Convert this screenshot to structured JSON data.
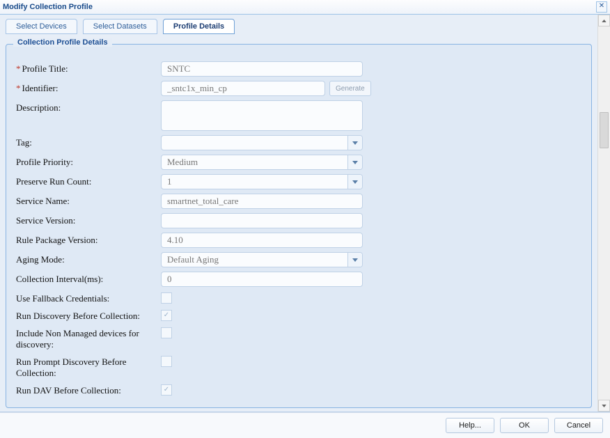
{
  "window": {
    "title": "Modify Collection Profile"
  },
  "tabs": [
    {
      "label": "Select Devices",
      "active": false
    },
    {
      "label": "Select Datasets",
      "active": false
    },
    {
      "label": "Profile Details",
      "active": true
    }
  ],
  "fieldset_title": "Collection Profile Details",
  "form": {
    "profile_title": {
      "label": "Profile Title:",
      "value": "SNTC",
      "required": true
    },
    "identifier": {
      "label": "Identifier:",
      "value": "_sntc1x_min_cp",
      "required": true,
      "generate_label": "Generate"
    },
    "description": {
      "label": "Description:",
      "value": ""
    },
    "tag": {
      "label": "Tag:",
      "value": ""
    },
    "profile_priority": {
      "label": "Profile Priority:",
      "value": "Medium"
    },
    "preserve_run_count": {
      "label": "Preserve Run Count:",
      "value": "1"
    },
    "service_name": {
      "label": "Service Name:",
      "value": "smartnet_total_care"
    },
    "service_version": {
      "label": "Service Version:",
      "value": ""
    },
    "rule_package_version": {
      "label": "Rule Package Version:",
      "value": "4.10"
    },
    "aging_mode": {
      "label": "Aging Mode:",
      "value": "Default Aging"
    },
    "collection_interval": {
      "label": "Collection Interval(ms):",
      "value": "0"
    },
    "use_fallback": {
      "label": "Use Fallback Credentials:",
      "checked": false
    },
    "run_discovery": {
      "label": "Run Discovery Before Collection:",
      "checked": true
    },
    "include_non_managed": {
      "label": "Include Non Managed devices for discovery:",
      "checked": false
    },
    "run_prompt_discovery": {
      "label": "Run Prompt Discovery Before Collection:",
      "checked": false
    },
    "run_dav": {
      "label": "Run DAV Before Collection:",
      "checked": true
    }
  },
  "footer": {
    "help": "Help...",
    "ok": "OK",
    "cancel": "Cancel"
  }
}
